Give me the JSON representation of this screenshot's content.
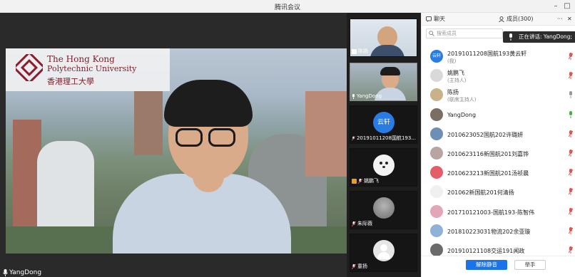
{
  "window": {
    "title": "腾讯会议"
  },
  "main_video": {
    "speaker_name": "YangDong",
    "logo_text": {
      "line1": "The Hong Kong",
      "line2": "Polytechnic University",
      "line3": "香港理工大學"
    }
  },
  "thumbnails": [
    {
      "name": "陈扬",
      "kind": "video"
    },
    {
      "name": "YangDong",
      "kind": "video",
      "active": true
    },
    {
      "name": "20191011208国航193...",
      "kind": "avatar",
      "avatar_text": "云轩",
      "avatar_color": "#2b7be4"
    },
    {
      "name": "姚鹏飞",
      "kind": "avatar-photo"
    },
    {
      "name": "朱际薇",
      "kind": "avatar-photo"
    },
    {
      "name": "童扬",
      "kind": "avatar-gray"
    }
  ],
  "panel": {
    "tab_chat": "聊天",
    "tab_members": "成员(300)",
    "more": "···",
    "close": "✕",
    "search_placeholder": "搜索成员",
    "speaking_tooltip": "正在讲话: YangDong;",
    "members": [
      {
        "name": "20191011208国航193黄云轩",
        "role": "(我)",
        "avatar_color": "#2b7be4",
        "avatar_text": "云轩",
        "mic": "muted"
      },
      {
        "name": "姚鹏飞",
        "role": "(主持人)",
        "avatar_color": "#d9d9d9",
        "mic": "muted"
      },
      {
        "name": "陈扬",
        "role": "(联席主持人)",
        "avatar_color": "#c9b28a",
        "mic": "on"
      },
      {
        "name": "YangDong",
        "role": "",
        "avatar_color": "#7b6f64",
        "mic": "speaking"
      },
      {
        "name": "2010623052国航202许璐妍",
        "role": "",
        "avatar_color": "#6d8fb5",
        "mic": "muted"
      },
      {
        "name": "2010623116新国航201刘嘉铧",
        "role": "",
        "avatar_color": "#b9a3a3",
        "mic": "muted"
      },
      {
        "name": "2010623213新国航201汤祯晨",
        "role": "",
        "avatar_color": "#e35d6a",
        "mic": "muted"
      },
      {
        "name": "201062新国航201何清扬",
        "role": "",
        "avatar_color": "#f0f0f0",
        "mic": "muted"
      },
      {
        "name": "201710121003-国航193-陈智伟",
        "role": "",
        "avatar_color": "#e3a6b9",
        "mic": "muted"
      },
      {
        "name": "20181022303​1物流202余亚璇",
        "role": "",
        "avatar_color": "#8fb3d6",
        "mic": "muted"
      },
      {
        "name": "20191012110​8交运191闻政",
        "role": "",
        "avatar_color": "#6b6b6b",
        "mic": "muted"
      }
    ],
    "unmute_all": "解除静音",
    "raise_hand": "举手"
  },
  "colors": {
    "accent": "#1a73e8",
    "muted_mic": "#e0554f",
    "active_mic": "#3cb43c"
  }
}
